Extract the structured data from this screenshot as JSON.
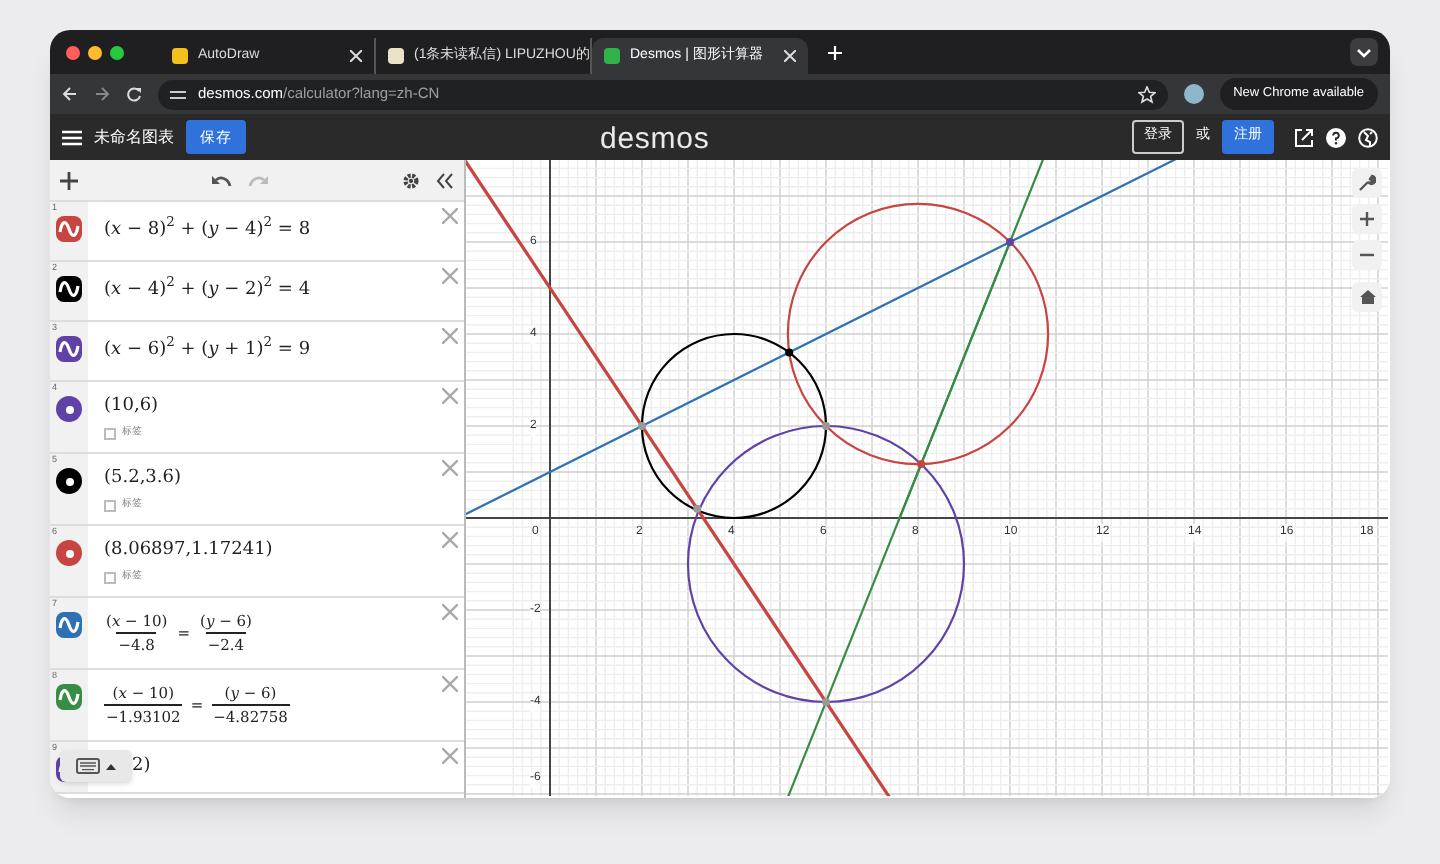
{
  "browser": {
    "tabs": [
      {
        "title": "AutoDraw",
        "selected": false
      },
      {
        "title": "(1条未读私信) LIPUZHOU的",
        "selected": false
      },
      {
        "title": "Desmos | 图形计算器",
        "selected": true
      }
    ],
    "url_host": "desmos.com",
    "url_path": "/calculator?lang=zh-CN",
    "update_button": "New Chrome available"
  },
  "header": {
    "graph_title": "未命名图表",
    "save_button": "保存",
    "logo": "desmos",
    "login_button": "登录",
    "or_text": "或",
    "signup_button": "注册"
  },
  "expressions": [
    {
      "index": "1",
      "kind": "curve",
      "color": "#c74440",
      "latex": "(*x* − 8)$^{2}$ + (*y* − 4)$^{2}$ = 8"
    },
    {
      "index": "2",
      "kind": "curve",
      "color": "#000000",
      "latex": "(*x* − 4)$^{2}$ + (*y* − 2)$^{2}$ = 4"
    },
    {
      "index": "3",
      "kind": "curve",
      "color": "#6042a6",
      "latex": "(*x* − 6)$^{2}$ + (*y* + 1)$^{2}$ = 9"
    },
    {
      "index": "4",
      "kind": "point",
      "color": "#6042a6",
      "latex": "(10,6)",
      "label_option": "标签",
      "label_checked": false
    },
    {
      "index": "5",
      "kind": "point",
      "color": "#000000",
      "latex": "(5.2,3.6)",
      "label_option": "标签",
      "label_checked": false
    },
    {
      "index": "6",
      "kind": "point",
      "color": "#c74440",
      "latex": "(8.06897,1.17241)",
      "label_option": "标签",
      "label_checked": false
    },
    {
      "index": "7",
      "kind": "fraction",
      "color": "#2d70b3",
      "left_num": "(*x* − 10)",
      "left_den": "−4.8",
      "equals": "=",
      "right_num": "(*y* − 6)",
      "right_den": "−2.4"
    },
    {
      "index": "8",
      "kind": "fraction",
      "color": "#388c46",
      "left_num": "(*x* − 10)",
      "left_den": "−1.93102",
      "equals": "=",
      "right_num": "(*y* − 6)",
      "right_den": "−4.82758"
    },
    {
      "index": "9",
      "kind": "partial",
      "color": "#6042a6",
      "latex": "2)"
    }
  ],
  "graph": {
    "x_ticks": [
      "0",
      "2",
      "4",
      "6",
      "8",
      "10",
      "12",
      "14",
      "16",
      "18"
    ],
    "y_ticks": [
      "6",
      "4",
      "2",
      "-2",
      "-4",
      "-6"
    ]
  }
}
